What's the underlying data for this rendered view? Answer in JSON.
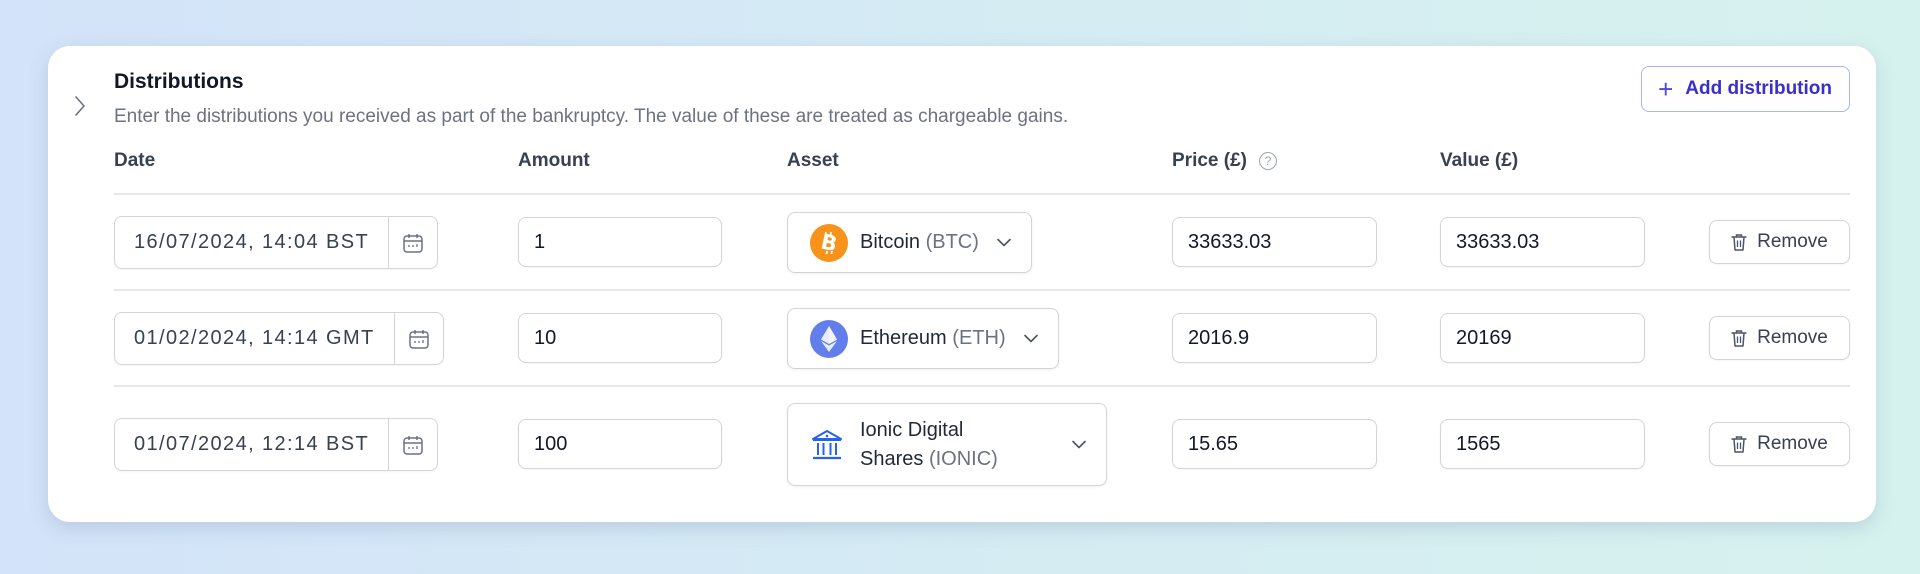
{
  "section": {
    "title": "Distributions",
    "description": "Enter the distributions you received as part of the bankruptcy. The value of these are treated as chargeable gains.",
    "add_button_label": "Add distribution",
    "add_button_icon": "plus-icon",
    "expand_icon": "chevron-right-icon"
  },
  "table": {
    "columns": {
      "date": "Date",
      "amount": "Amount",
      "asset": "Asset",
      "price": "Price (£)",
      "value": "Value (£)"
    },
    "price_help_icon": "?",
    "remove_label": "Remove",
    "rows": [
      {
        "date": "16/07/2024, 14:04 BST",
        "amount": "1",
        "asset_name": "Bitcoin",
        "asset_ticker": "(BTC)",
        "asset_icon": "bitcoin-icon",
        "price": "33633.03",
        "value": "33633.03"
      },
      {
        "date": "01/02/2024, 14:14 GMT",
        "amount": "10",
        "asset_name": "Ethereum",
        "asset_ticker": "(ETH)",
        "asset_icon": "ethereum-icon",
        "price": "2016.9",
        "value": "20169"
      },
      {
        "date": "01/07/2024, 12:14 BST",
        "amount": "100",
        "asset_name_line1": "Ionic Digital",
        "asset_name_line2": "Shares",
        "asset_ticker": "(IONIC)",
        "asset_icon": "bank-icon",
        "price": "15.65",
        "value": "1565"
      }
    ]
  },
  "colors": {
    "accent": "#4f46e5",
    "bitcoin": "#f7931a",
    "ethereum": "#627eea",
    "bank": "#2563eb"
  }
}
